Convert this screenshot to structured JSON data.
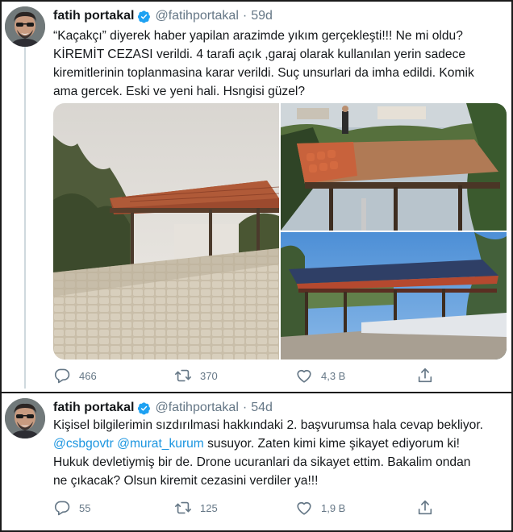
{
  "tweets": [
    {
      "author_name": "fatih portakal",
      "handle": "@fatihportakal",
      "separator": "·",
      "time": "59d",
      "text_lines": [
        "“Kaçakçı” diyerek haber yapilan arazimde yıkım gerçekleşti!!! Ne mi oldu?",
        "KİREMİT CEZASI verildi. 4 tarafi açık ,garaj olarak kullanılan yerin sadece",
        "kiremitlerinin toplanmasina karar verildi. Suç unsurlari da imha edildi. Komik",
        "ama gercek. Eski ve yeni hali. Hsngisi güzel?"
      ],
      "replies": "466",
      "retweets": "370",
      "likes": "4,3 B",
      "media_count": 3
    },
    {
      "author_name": "fatih portakal",
      "handle": "@fatihportakal",
      "separator": "·",
      "time": "54d",
      "line1": "Kişisel bilgilerimin sızdırılmasi hakkındaki 2. başvurumsa hala cevap bekliyor.",
      "mention1": "@csbgovtr",
      "mention2": "@murat_kurum",
      "line2_rest": " susuyor. Zaten kimi kime şikayet ediyorum ki!",
      "line3": "Hukuk devletiymiş bir de. Drone ucuranlari da sikayet ettim. Bakalim ondan",
      "line4": "ne çıkacak? Olsun kiremit cezasini verdiler ya!!!",
      "replies": "55",
      "retweets": "125",
      "likes": "1,9 B"
    }
  ],
  "colors": {
    "accent": "#1b95e0",
    "verified": "#1da1f2",
    "muted": "#657786",
    "text": "#14171a"
  },
  "icons": {
    "reply": "speech-bubble-icon",
    "retweet": "retweet-arrows-icon",
    "like": "heart-outline-icon",
    "share": "share-upload-icon",
    "verified": "verified-badge-icon"
  }
}
